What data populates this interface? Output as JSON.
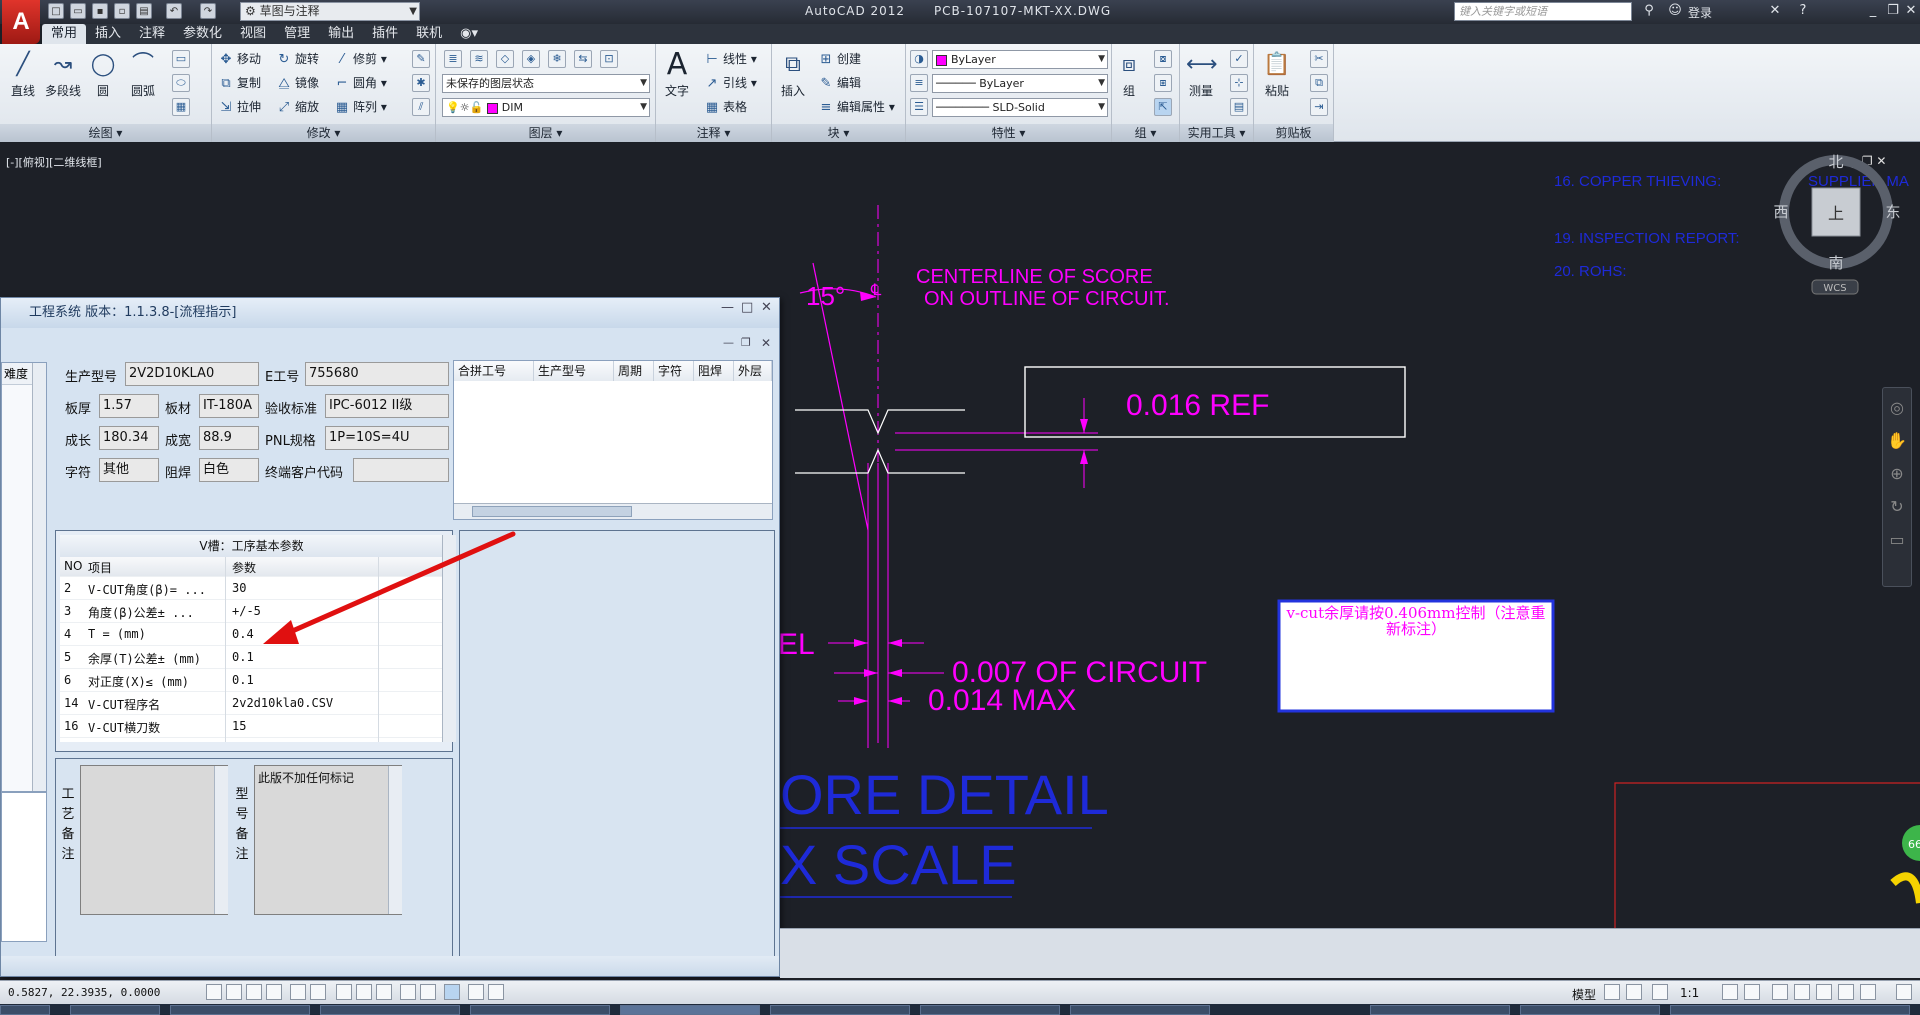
{
  "titlebar": {
    "workspace": "草图与注释",
    "app_name": "AutoCAD 2012",
    "file_name": "PCB-107107-MKT-XX.DWG",
    "search_placeholder": "键入关键字或短语",
    "login": "登录",
    "logo_letter": "A"
  },
  "menu_tabs": [
    "常用",
    "插入",
    "注释",
    "参数化",
    "视图",
    "管理",
    "输出",
    "插件",
    "联机"
  ],
  "ribbon": {
    "draw": {
      "title": "绘图",
      "line": "直线",
      "polyline": "多段线",
      "circle": "圆",
      "arc": "圆弧"
    },
    "modify": {
      "title": "修改",
      "move": "移动",
      "rotate": "旋转",
      "trim": "修剪",
      "copy": "复制",
      "mirror": "镜像",
      "fillet": "圆角",
      "stretch": "拉伸",
      "scale": "缩放",
      "array": "阵列"
    },
    "layers": {
      "title": "图层",
      "state": "未保存的图层状态",
      "layer": "DIM"
    },
    "annotation": {
      "title": "注释",
      "text": "文字",
      "linear": "线性",
      "leader": "引线",
      "table": "表格"
    },
    "block": {
      "title": "块",
      "insert": "插入",
      "create": "创建",
      "edit": "编辑",
      "edit_attr": "编辑属性"
    },
    "properties": {
      "title": "特性",
      "color": "ByLayer",
      "linetype": "ByLayer",
      "lineweight": "SLD-Solid"
    },
    "groups": {
      "title": "组",
      "group": "组"
    },
    "utilities": {
      "title": "实用工具",
      "measure": "测量"
    },
    "clipboard": {
      "title": "剪贴板",
      "paste": "粘贴"
    }
  },
  "viewport": {
    "label": "[-][俯视][二维线框]"
  },
  "viewcube": {
    "north": "北",
    "south": "南",
    "east": "东",
    "west": "西",
    "top": "上",
    "wcs": "WCS"
  },
  "drawing": {
    "angle": "15°",
    "centerline_note_1": "CENTERLINE OF SCORE",
    "centerline_note_2": "ON OUTLINE OF CIRCUIT.",
    "ref_dim": "0.016  REF",
    "el_fragment": "EL",
    "circuit_dim": "0.007 OF CIRCUIT",
    "max_dim": "0.014 MAX",
    "detail_title": "ORE DETAIL",
    "scale_title": "X SCALE",
    "note_16": "16. COPPER THIEVING:",
    "note_19": "19. INSPECTION REPORT:",
    "note_20": "20. ROHS:",
    "supplier": "SUPPLIER MA",
    "vcut_note": "v-cut余厚请按0.406mm控制（注意重新标注）",
    "badge": "66"
  },
  "dialog": {
    "title": "工程系统 版本：1.1.3.8-[流程指示]",
    "left_header": "难度",
    "fields": {
      "prod_no_label": "生产型号",
      "prod_no": "2V2D10KLA0",
      "e_no_label": "E工号",
      "e_no": "755680",
      "thickness_label": "板厚",
      "thickness": "1.57",
      "material_label": "板材",
      "material": "IT-180A",
      "standard_label": "验收标准",
      "standard": "IPC-6012 II级",
      "length_label": "成长",
      "length": "180.34",
      "width_label": "成宽",
      "width": "88.9",
      "pnl_label": "PNL规格",
      "pnl": "1P=10S=4U",
      "legend_label": "字符",
      "legend": "其他",
      "mask_label": "阻焊",
      "mask": "白色",
      "customer_label": "终端客户代码",
      "customer": ""
    },
    "grid_headers": [
      "合拼工号",
      "生产型号",
      "周期",
      "字符",
      "阻焊",
      "外层"
    ],
    "vslot": {
      "title": "V槽：工序基本参数",
      "col_no": "NO",
      "col_item": "项目",
      "col_param": "参数",
      "rows": [
        {
          "no": "2",
          "item": "V-CUT角度(β)=  ...",
          "param": "30"
        },
        {
          "no": "3",
          "item": "角度(β)公差±   ...",
          "param": "+/-5"
        },
        {
          "no": "4",
          "item": "T =  (mm)",
          "param": "0.4"
        },
        {
          "no": "5",
          "item": "余厚(T)公差±  (mm)",
          "param": "0.1"
        },
        {
          "no": "6",
          "item": "对正度(X)≤ (mm)",
          "param": "0.1"
        },
        {
          "no": "14",
          "item": "V-CUT程序名",
          "param": "2v2d10kla0.CSV"
        },
        {
          "no": "16",
          "item": "V-CUT横刀数",
          "param": "15"
        }
      ]
    },
    "process_note_label": "工艺备注",
    "model_note_label": "型号备注",
    "model_note": "此版不加任何标记"
  },
  "status": {
    "coords": "0.5827, 22.3935, 0.0000",
    "model": "模型",
    "scale": "1:1"
  },
  "colors": {
    "magenta": "#ff00ff",
    "blue": "#0000ff",
    "arrow": "#e01010",
    "dark_bg": "#1d2027"
  }
}
